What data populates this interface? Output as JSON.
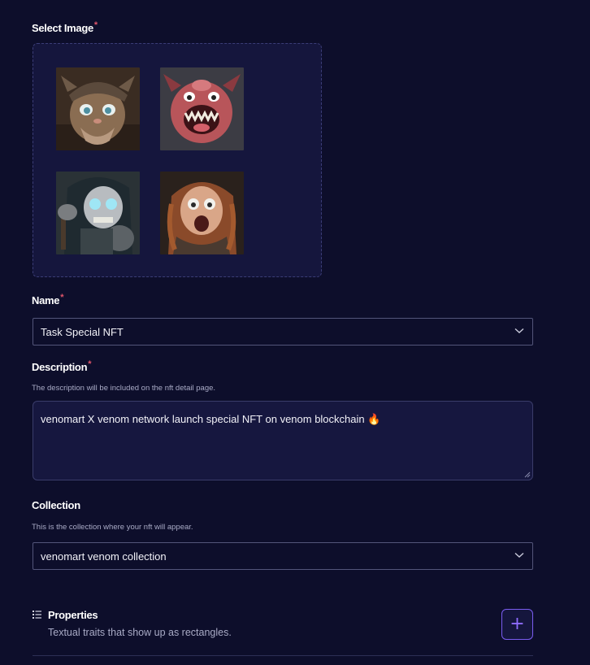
{
  "select_image": {
    "label": "Select Image",
    "required_mark": "*"
  },
  "images": [
    {
      "icon": "cat-viking-thumbnail"
    },
    {
      "icon": "red-monster-thumbnail"
    },
    {
      "icon": "skull-warrior-thumbnail"
    },
    {
      "icon": "screaming-viking-thumbnail"
    }
  ],
  "name": {
    "label": "Name",
    "required_mark": "*",
    "value": "Task Special NFT"
  },
  "description": {
    "label": "Description",
    "required_mark": "*",
    "hint": "The description will be included on the nft detail page.",
    "value": "venomart X venom network launch special NFT on venom blockchain 🔥"
  },
  "collection": {
    "label": "Collection",
    "hint": "This is the collection where your nft will appear.",
    "value": "venomart venom collection"
  },
  "properties": {
    "title": "Properties",
    "description": "Textual traits that show up as rectangles.",
    "add_label": "+"
  },
  "colors": {
    "accent": "#7a5cf0",
    "background": "#0d0e2b",
    "required": "#e0556a"
  }
}
